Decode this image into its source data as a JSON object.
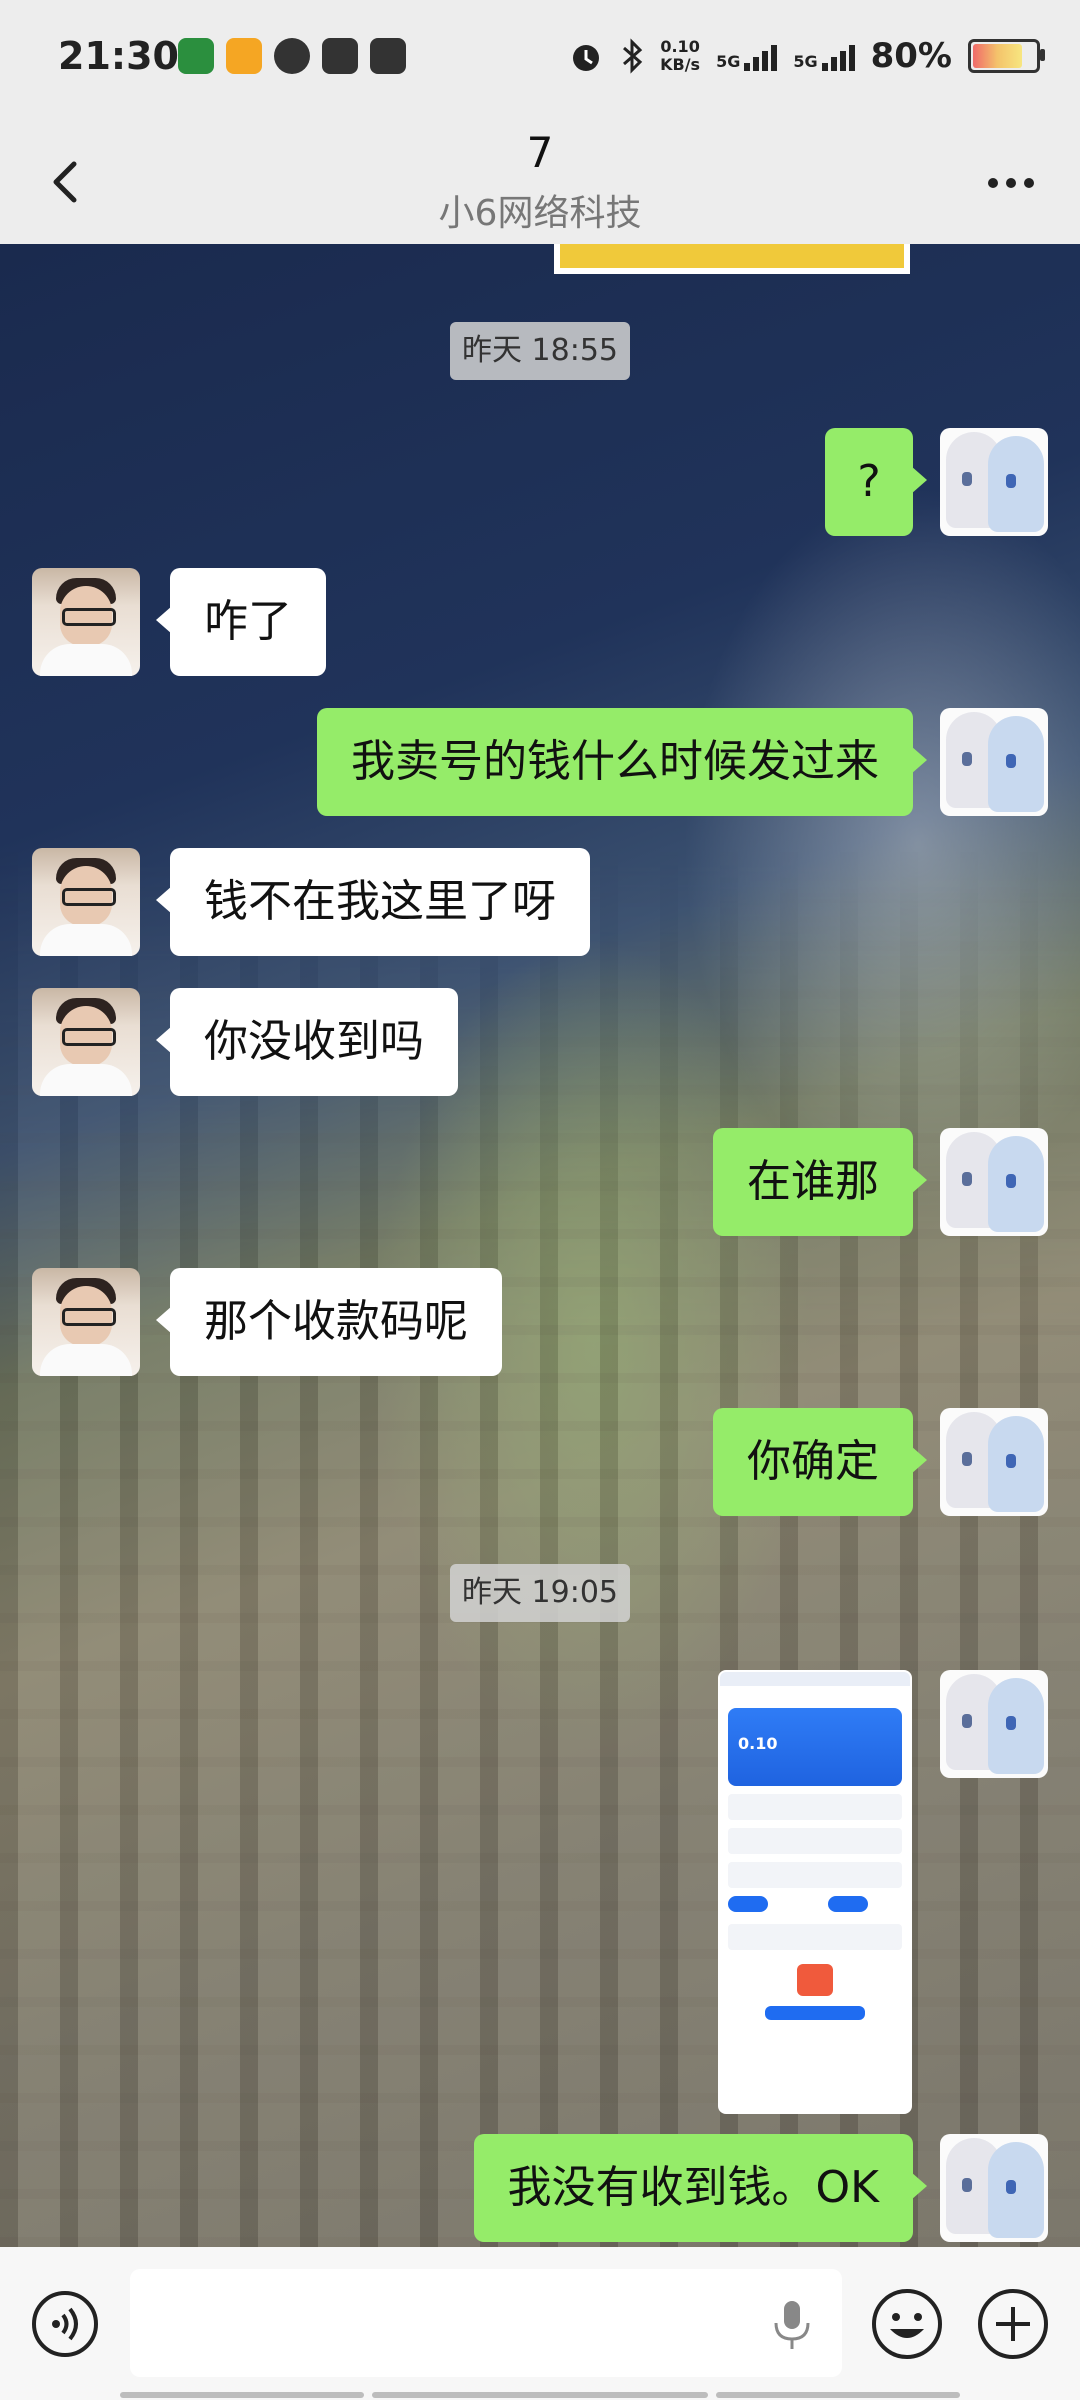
{
  "status_bar": {
    "time": "21:30",
    "net_speed_value": "0.10",
    "net_speed_unit": "KB/s",
    "sim1": "5G",
    "sim2": "5G",
    "battery_percent": "80%",
    "battery_level": 0.8
  },
  "header": {
    "title": "7",
    "subtitle": "小6网络科技"
  },
  "chat": {
    "timestamps": [
      "昨天 18:55",
      "昨天 19:05"
    ],
    "messages": [
      {
        "side": "out",
        "text": "?"
      },
      {
        "side": "in",
        "text": "咋了"
      },
      {
        "side": "out",
        "text": "我卖号的钱什么时候发过来"
      },
      {
        "side": "in",
        "text": "钱不在我这里了呀"
      },
      {
        "side": "in",
        "text": "你没收到吗"
      },
      {
        "side": "out",
        "text": "在谁那"
      },
      {
        "side": "in",
        "text": "那个收款码呢"
      },
      {
        "side": "out",
        "text": "你确定"
      },
      {
        "side": "out",
        "type": "image",
        "image_value": "0.10"
      },
      {
        "side": "out",
        "text": "我没有收到钱。OK"
      }
    ]
  },
  "input_bar": {
    "placeholder": ""
  },
  "icons": {
    "back": "chevron-left-icon",
    "more": "more-icon",
    "voice": "voice-icon",
    "mic": "mic-icon",
    "emoji": "emoji-icon",
    "plus": "plus-icon"
  },
  "colors": {
    "sent_bubble": "#95ec69",
    "received_bubble": "#ffffff",
    "timestamp_bg": "#d2d2d2"
  }
}
